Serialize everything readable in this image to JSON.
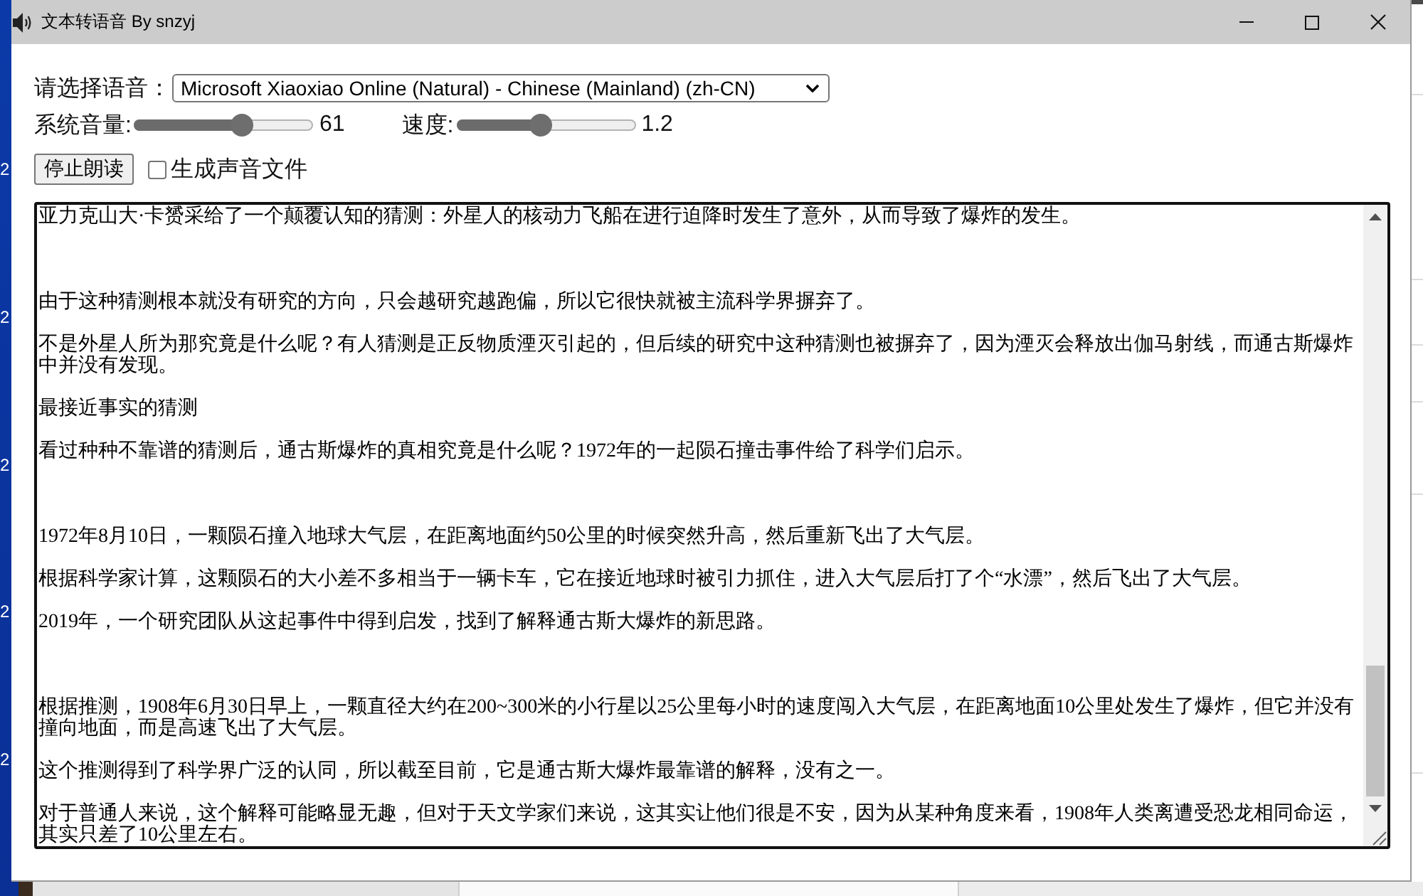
{
  "desktop": {
    "icon_labels": [
      "2",
      "2",
      "2",
      "2",
      "2"
    ]
  },
  "window": {
    "title": "文本转语音 By snzyj"
  },
  "voice": {
    "label": "请选择语音：",
    "value": "Microsoft Xiaoxiao Online (Natural) - Chinese (Mainland) (zh-CN)"
  },
  "sliders": [
    {
      "label": "系统音量:",
      "level": 0.61,
      "reading": "61"
    },
    {
      "label": "速度:",
      "level": 0.47,
      "reading": "1.2"
    }
  ],
  "stop_button": {
    "label": "停止朗读"
  },
  "save_audio": {
    "label": "生成声音文件",
    "checked": false
  },
  "text_area": {
    "sections": [
      {
        "paragraphs": [
          "亚力克山大·卡赟采给了一个颠覆认知的猜测：外星人的核动力飞船在进行迫降时发生了意外，从而导致了爆炸的发生。"
        ]
      },
      {
        "paragraphs": [
          "由于这种猜测根本就没有研究的方向，只会越研究越跑偏，所以它很快就被主流科学界摒弃了。",
          "不是外星人所为那究竟是什么呢？有人猜测是正反物质湮灭引起的，但后续的研究中这种猜测也被摒弃了，因为湮灭会释放出伽马射线，而通古斯爆炸中并没有发现。",
          "最接近事实的猜测",
          "看过种种不靠谱的猜测后，通古斯爆炸的真相究竟是什么呢？1972年的一起陨石撞击事件给了科学们启示。"
        ]
      },
      {
        "paragraphs": [
          "1972年8月10日，一颗陨石撞入地球大气层，在距离地面约50公里的时候突然升高，然后重新飞出了大气层。",
          "根据科学家计算，这颗陨石的大小差不多相当于一辆卡车，它在接近地球时被引力抓住，进入大气层后打了个“水漂”，然后飞出了大气层。",
          "2019年，一个研究团队从这起事件中得到启发，找到了解释通古斯大爆炸的新思路。"
        ]
      },
      {
        "paragraphs": [
          "根据推测，1908年6月30日早上，一颗直径大约在200~300米的小行星以25公里每小时的速度闯入大气层，在距离地面10公里处发生了爆炸，但它并没有撞向地面，而是高速飞出了大气层。",
          "这个推测得到了科学界广泛的认同，所以截至目前，它是通古斯大爆炸最靠谱的解释，没有之一。",
          "对于普通人来说，这个解释可能略显无趣，但对于天文学家们来说，这其实让他们很是不安，因为从某种角度来看，1908年人类离遭受恐龙相同命运，其实只差了10公里左右。"
        ]
      }
    ]
  }
}
